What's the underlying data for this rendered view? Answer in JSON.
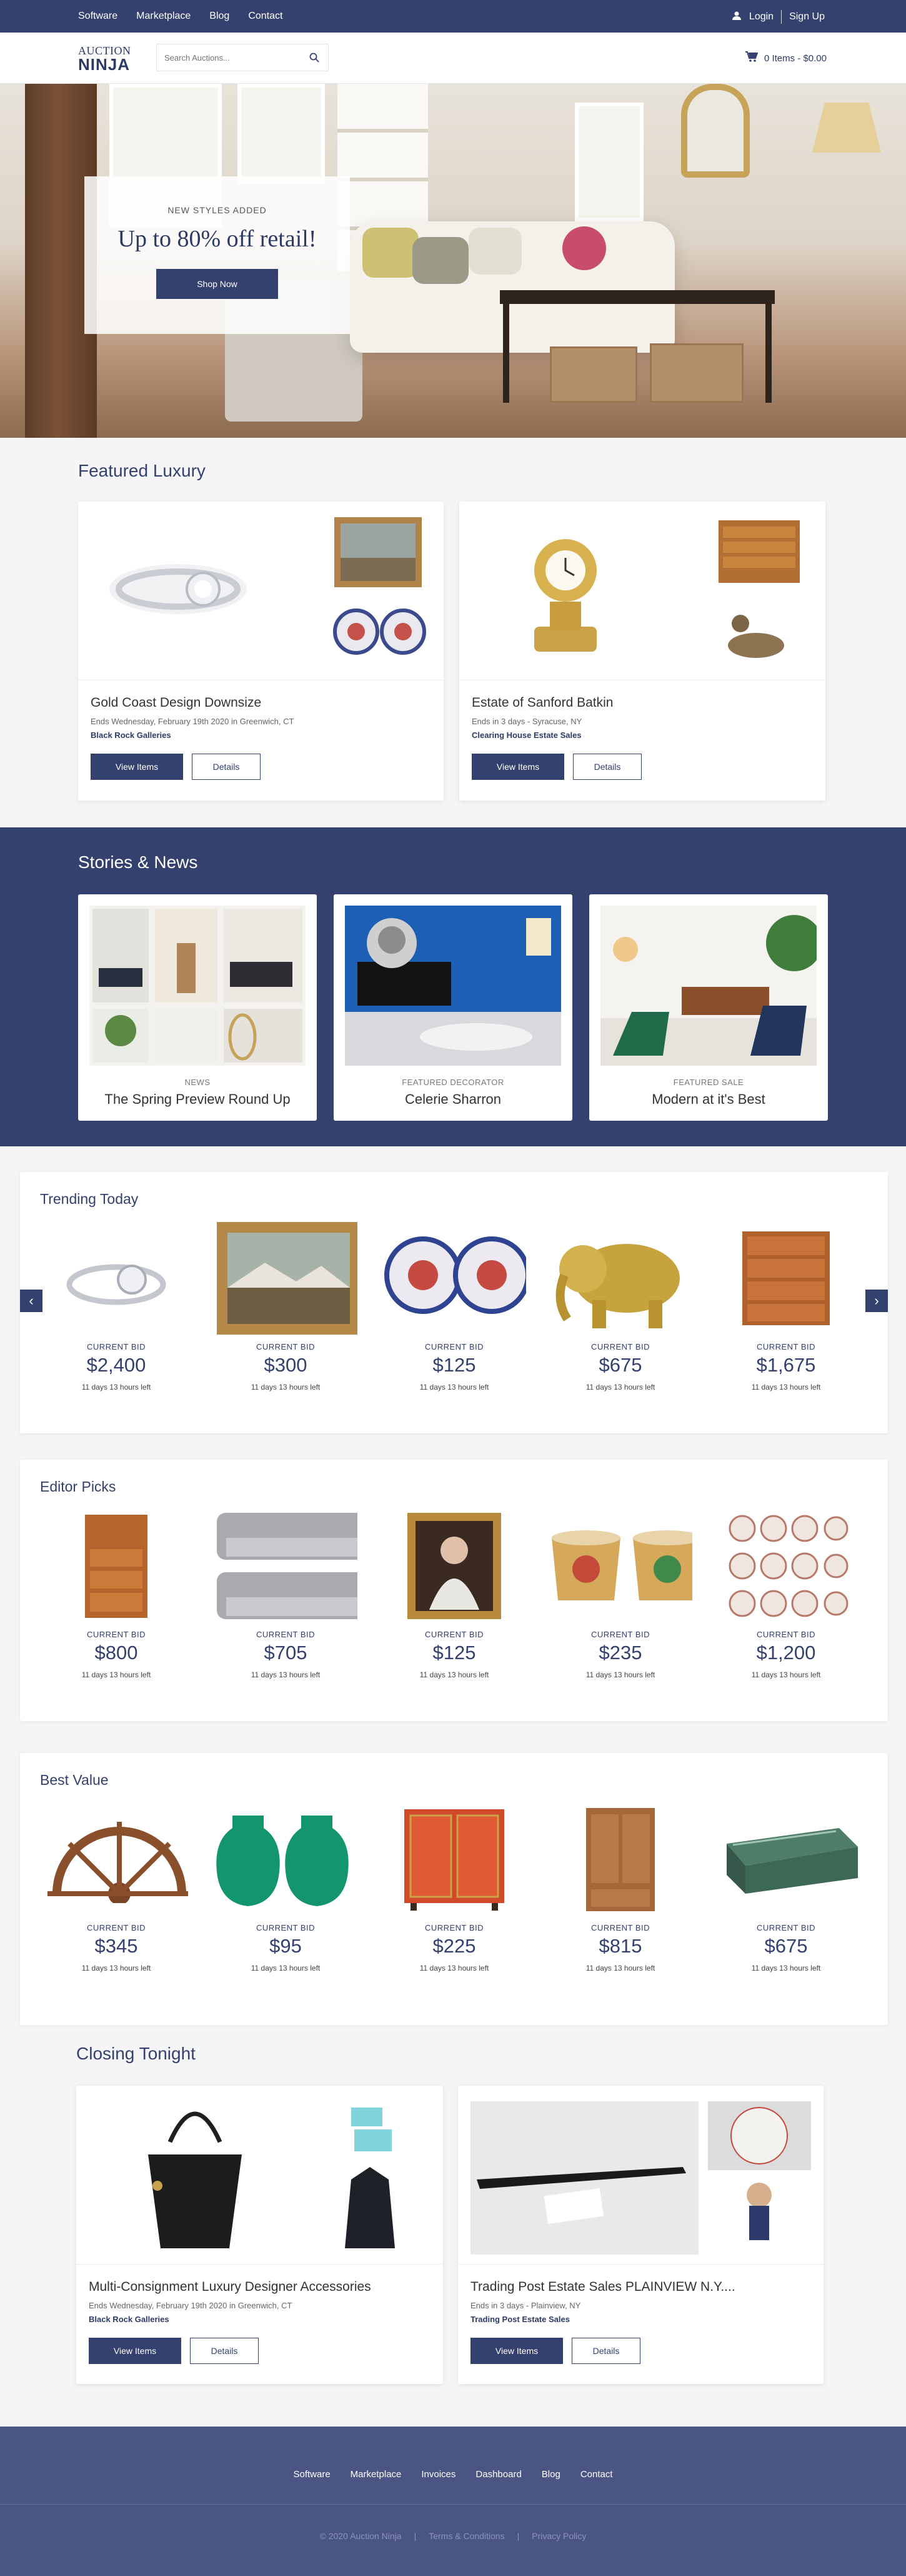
{
  "topnav": {
    "links": [
      "Software",
      "Marketplace",
      "Blog",
      "Contact"
    ],
    "login": "Login",
    "signup": "Sign Up"
  },
  "header": {
    "logo_top": "AUCTION",
    "logo_bottom": "NINJA",
    "search_placeholder": "Search Auctions...",
    "cart": "0 Items - $0.00"
  },
  "hero": {
    "pre": "NEW STYLES ADDED",
    "title": "Up to 80% off retail!",
    "button": "Shop Now"
  },
  "featured": {
    "title": "Featured Luxury",
    "cards": [
      {
        "title": "Gold Coast Design Downsize",
        "meta": "Ends Wednesday, February 19th 2020 in Greenwich, CT",
        "house": "Black Rock Galleries",
        "view": "View Items",
        "details": "Details"
      },
      {
        "title": "Estate of Sanford Batkin",
        "meta": "Ends in 3 days - Syracuse, NY",
        "house": "Clearing House Estate Sales",
        "view": "View Items",
        "details": "Details"
      }
    ]
  },
  "stories": {
    "title": "Stories & News",
    "items": [
      {
        "kicker": "NEWS",
        "title": "The Spring Preview Round Up"
      },
      {
        "kicker": "FEATURED DECORATOR",
        "title": "Celerie Sharron"
      },
      {
        "kicker": "FEATURED SALE",
        "title": "Modern at it's Best"
      }
    ]
  },
  "trending": {
    "title": "Trending Today",
    "items": [
      {
        "label": "CURRENT BID",
        "bid": "$2,400",
        "time": "11 days 13 hours left"
      },
      {
        "label": "CURRENT BID",
        "bid": "$300",
        "time": "11 days 13 hours left"
      },
      {
        "label": "CURRENT BID",
        "bid": "$125",
        "time": "11 days 13 hours left"
      },
      {
        "label": "CURRENT BID",
        "bid": "$675",
        "time": "11 days 13 hours left"
      },
      {
        "label": "CURRENT BID",
        "bid": "$1,675",
        "time": "11 days 13 hours left"
      }
    ]
  },
  "editor": {
    "title": "Editor Picks",
    "items": [
      {
        "label": "CURRENT BID",
        "bid": "$800",
        "time": "11 days 13 hours left"
      },
      {
        "label": "CURRENT BID",
        "bid": "$705",
        "time": "11 days 13 hours left"
      },
      {
        "label": "CURRENT BID",
        "bid": "$125",
        "time": "11 days 13 hours left"
      },
      {
        "label": "CURRENT BID",
        "bid": "$235",
        "time": "11 days 13 hours left"
      },
      {
        "label": "CURRENT BID",
        "bid": "$1,200",
        "time": "11 days 13 hours left"
      }
    ]
  },
  "bestvalue": {
    "title": "Best Value",
    "items": [
      {
        "label": "CURRENT BID",
        "bid": "$345",
        "time": "11 days 13 hours left"
      },
      {
        "label": "CURRENT BID",
        "bid": "$95",
        "time": "11 days 13 hours left"
      },
      {
        "label": "CURRENT BID",
        "bid": "$225",
        "time": "11 days 13 hours left"
      },
      {
        "label": "CURRENT BID",
        "bid": "$815",
        "time": "11 days 13 hours left"
      },
      {
        "label": "CURRENT BID",
        "bid": "$675",
        "time": "11 days 13 hours left"
      }
    ]
  },
  "closing": {
    "title": "Closing Tonight",
    "cards": [
      {
        "title": "Multi-Consignment Luxury Designer Accessories",
        "meta": "Ends Wednesday, February 19th 2020 in Greenwich, CT",
        "house": "Black Rock Galleries",
        "view": "View Items",
        "details": "Details"
      },
      {
        "title": "Trading Post Estate Sales PLAINVIEW N.Y....",
        "meta": "Ends in 3 days - Plainview, NY",
        "house": "Trading Post Estate Sales",
        "view": "View Items",
        "details": "Details"
      }
    ]
  },
  "footer": {
    "links": [
      "Software",
      "Marketplace",
      "Invoices",
      "Dashboard",
      "Blog",
      "Contact"
    ],
    "copyright": "© 2020 Auction Ninja",
    "terms": "Terms & Conditions",
    "privacy": "Privacy Policy",
    "divider": "|"
  },
  "arrows": {
    "prev": "‹",
    "next": "›"
  },
  "colors": {
    "brand": "#34406e",
    "footer": "#4b5584",
    "background": "#f5f5f7"
  }
}
